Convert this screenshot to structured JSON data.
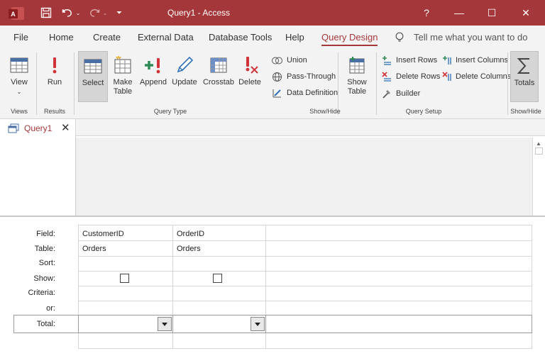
{
  "titlebar": {
    "title": "Query1  -  Access",
    "help": "?",
    "minimize": "—",
    "maximize": "☐",
    "close": "✕",
    "accent": "#a4373a"
  },
  "tabs": [
    {
      "label": "File"
    },
    {
      "label": "Home"
    },
    {
      "label": "Create"
    },
    {
      "label": "External Data"
    },
    {
      "label": "Database Tools"
    },
    {
      "label": "Help"
    },
    {
      "label": "Query Design",
      "active": true
    }
  ],
  "tell_me": "Tell me what you want to do",
  "ribbon": {
    "view": "View",
    "run": "Run",
    "select": "Select",
    "make_table_1": "Make",
    "make_table_2": "Table",
    "append": "Append",
    "update": "Update",
    "crosstab": "Crosstab",
    "delete": "Delete",
    "union": "Union",
    "pass_through": "Pass-Through",
    "data_definition": "Data Definition",
    "show_table_1": "Show",
    "show_table_2": "Table",
    "insert_rows": "Insert Rows",
    "delete_rows": "Delete Rows",
    "builder": "Builder",
    "insert_columns": "Insert Columns",
    "delete_columns": "Delete Columns",
    "totals": "Totals",
    "group_views": "Views",
    "group_results": "Results",
    "group_query_type": "Query Type",
    "group_show_hide": "Show/Hide",
    "group_query_setup": "Query Setup",
    "group_show_hide_2": "Show/Hide"
  },
  "doc_tab": {
    "label": "Query1",
    "close": "✕"
  },
  "grid": {
    "row_labels": {
      "field": "Field:",
      "table": "Table:",
      "sort": "Sort:",
      "show": "Show:",
      "criteria": "Criteria:",
      "or": "or:",
      "total": "Total:"
    },
    "columns": [
      {
        "field": "CustomerID",
        "table": "Orders",
        "show": false,
        "total": ""
      },
      {
        "field": "OrderID",
        "table": "Orders",
        "show": false,
        "total": ""
      }
    ]
  }
}
